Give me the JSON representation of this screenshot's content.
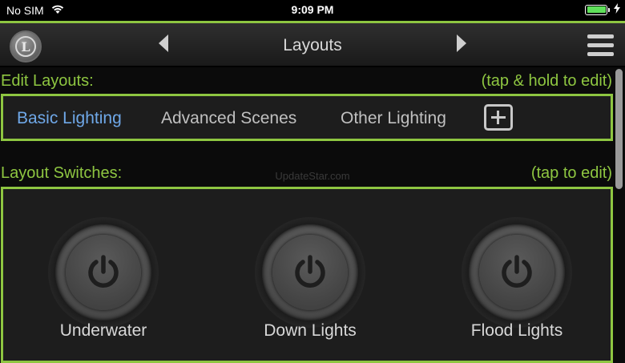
{
  "status_bar": {
    "carrier": "No SIM",
    "time": "9:09 PM",
    "battery_level": 1.0,
    "wifi_icon": "wifi-icon",
    "charging_icon": "bolt-icon"
  },
  "nav": {
    "title": "Layouts",
    "logo_letter": "L"
  },
  "edit_layouts": {
    "label": "Edit Layouts:",
    "hint": "(tap & hold to edit)",
    "tabs": [
      {
        "label": "Basic Lighting",
        "active": true
      },
      {
        "label": "Advanced Scenes",
        "active": false
      },
      {
        "label": "Other Lighting",
        "active": false
      }
    ]
  },
  "layout_switches": {
    "label": "Layout Switches:",
    "hint": "(tap to edit)",
    "switches": [
      {
        "label": "Underwater"
      },
      {
        "label": "Down Lights"
      },
      {
        "label": "Flood Lights"
      }
    ]
  },
  "watermark": "UpdateStar.com",
  "colors": {
    "accent": "#8ec641",
    "active_tab": "#6fa8e8",
    "background": "#0b0b0b"
  }
}
